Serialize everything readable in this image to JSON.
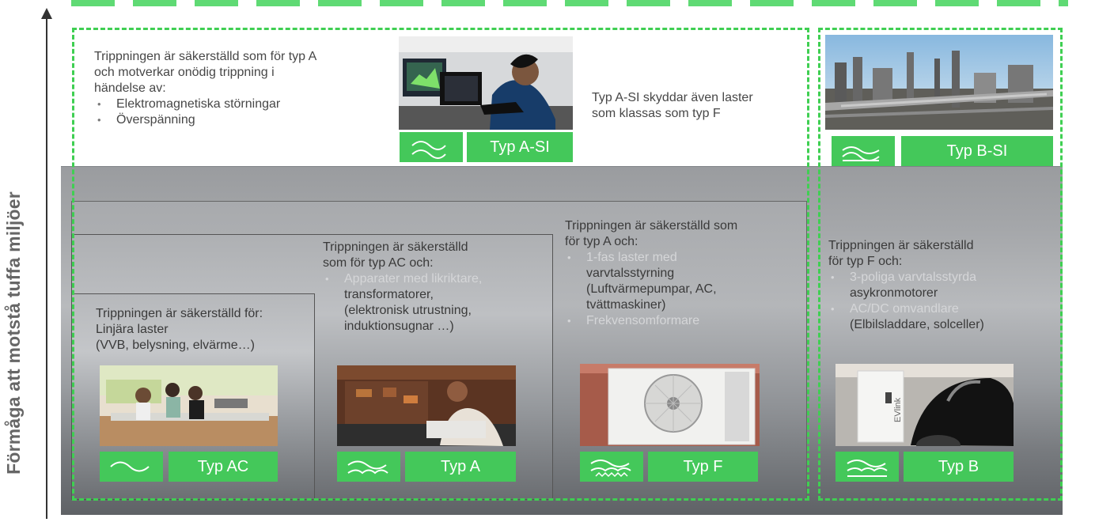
{
  "y_axis": {
    "label": "Förmåga att motstå tuffa miljöer"
  },
  "top_left": {
    "intro": [
      "Trippningen är säkerställd som för typ A",
      "och motverkar onödig trippning i",
      "händelse av:"
    ],
    "bullets": [
      "Elektromagnetiska störningar",
      "Överspänning"
    ],
    "side_text": [
      "Typ A-SI skyddar även laster",
      "som klassas som typ F"
    ],
    "badge": "Typ A-SI"
  },
  "top_right": {
    "badge": "Typ B-SI"
  },
  "cards": [
    {
      "text_lines": [
        "Trippningen är säkerställd för:",
        "Linjära laster",
        "(VVB, belysning, elvärme…)"
      ],
      "badge": "Typ AC"
    },
    {
      "text_lines": [
        "Trippningen är säkerställd",
        "som för typ AC och:"
      ],
      "bullets": [
        "Apparater med likriktare,"
      ],
      "cont": [
        "transformatorer,",
        "(elektronisk utrustning,",
        "induktionsugnar …)"
      ],
      "badge": "Typ A"
    },
    {
      "text_lines": [
        "Trippningen är säkerställd som",
        "för typ A och:"
      ],
      "bullets": [
        "1-fas laster  med",
        "Frekvensomformare"
      ],
      "cont": [
        "varvtalsstyrning",
        "(Luftvärmepumpar, AC,",
        "tvättmaskiner)"
      ],
      "badge": "Typ F"
    },
    {
      "text_lines": [
        "Trippningen är säkerställd",
        "för typ F och:"
      ],
      "bullets": [
        "3-poliga varvtalsstyrda",
        "AC/DC omvandlare"
      ],
      "cont": [
        "asykronmotorer",
        "(Elbilsladdare, solceller)"
      ],
      "badge": "Typ B"
    }
  ],
  "charger_text": "EVlink",
  "colors": {
    "green": "#44c85a",
    "dashed_green": "#3fcf52",
    "text_dark": "#474747",
    "text_light": "#d5d6d8"
  }
}
